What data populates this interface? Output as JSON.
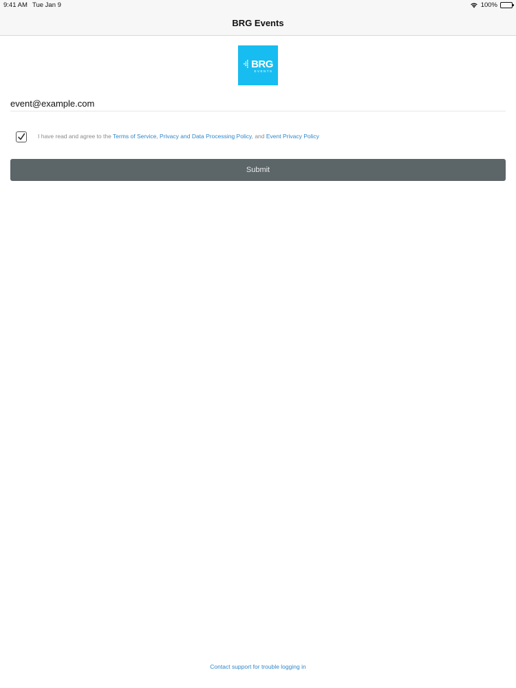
{
  "status_bar": {
    "time": "9:41 AM",
    "date": "Tue Jan 9",
    "battery": "100%",
    "wifi_icon": "wifi-icon",
    "battery_icon": "battery-icon"
  },
  "nav": {
    "title": "BRG Events"
  },
  "logo": {
    "text": "BRG",
    "subtext": "EVENTS",
    "color": "#17bdf0"
  },
  "form": {
    "email_value": "event@example.com",
    "agreement": {
      "checked": true,
      "prefix": "I have read and agree to the ",
      "terms_link": "Terms of Service",
      "sep1": ", ",
      "privacy_link": "Privacy and Data Processing Policy",
      "sep2": ", and ",
      "event_privacy_link": "Event Privacy Policy"
    },
    "submit_label": "Submit"
  },
  "footer": {
    "support_link": "Contact support for trouble logging in"
  },
  "colors": {
    "link": "#2f86c8",
    "button_bg": "#5c6568",
    "nav_bg": "#f7f7f8"
  }
}
